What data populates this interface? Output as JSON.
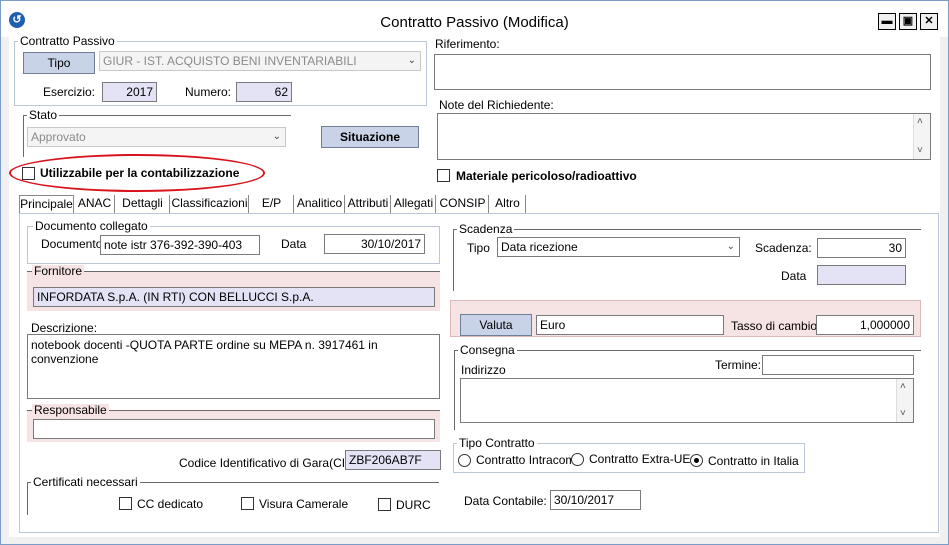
{
  "window": {
    "title": "Contratto Passivo (Modifica)",
    "minimize_symbol": "▬",
    "maximize_symbol": "▣",
    "close_symbol": "✕"
  },
  "contratto_passivo": {
    "group_label": "Contratto Passivo",
    "tipo_button": "Tipo",
    "tipo_value": "GIUR - IST. ACQUISTO BENI INVENTARIABILI",
    "esercizio_label": "Esercizio:",
    "esercizio_value": "2017",
    "numero_label": "Numero:",
    "numero_value": "62"
  },
  "riferimento": {
    "label": "Riferimento:",
    "value": ""
  },
  "note_richiedente": {
    "label": "Note del Richiedente:",
    "value": ""
  },
  "stato": {
    "group_label": "Stato",
    "value": "Approvato",
    "situazione_button": "Situazione"
  },
  "utilizzabile_label": "Utilizzabile per la contabilizzazione",
  "materiale_label": "Materiale pericoloso/radioattivo",
  "tabs": [
    {
      "label": "Principale"
    },
    {
      "label": "ANAC"
    },
    {
      "label": "Dettagli"
    },
    {
      "label": "Classificazioni"
    },
    {
      "label": "E/P"
    },
    {
      "label": "Analitico"
    },
    {
      "label": "Attributi"
    },
    {
      "label": "Allegati"
    },
    {
      "label": "CONSIP"
    },
    {
      "label": "Altro"
    }
  ],
  "documento_collegato": {
    "group_label": "Documento collegato",
    "documento_label": "Documento",
    "documento_value": "note istr 376-392-390-403",
    "data_label": "Data",
    "data_value": "30/10/2017"
  },
  "fornitore": {
    "group_label": "Fornitore",
    "value": "INFORDATA S.p.A. (IN RTI) CON BELLUCCI S.p.A."
  },
  "descrizione": {
    "label": "Descrizione:",
    "value": "notebook docenti -QUOTA PARTE ordine su MEPA n. 3917461  in convenzione"
  },
  "responsabile": {
    "group_label": "Responsabile",
    "value": ""
  },
  "cig": {
    "label": "Codice Identificativo di Gara(CIG)",
    "value": "ZBF206AB7F"
  },
  "certificati": {
    "group_label": "Certificati necessari",
    "items": [
      {
        "label": "CC dedicato"
      },
      {
        "label": "Visura Camerale"
      },
      {
        "label": "DURC"
      }
    ]
  },
  "scadenza": {
    "group_label": "Scadenza",
    "tipo_label": "Tipo",
    "tipo_value": "Data ricezione",
    "scadenza_label": "Scadenza:",
    "scadenza_value": "30",
    "data_label": "Data",
    "data_value": ""
  },
  "valuta": {
    "button": "Valuta",
    "value": "Euro",
    "tasso_label": "Tasso di cambio:",
    "tasso_value": "1,000000"
  },
  "consegna": {
    "group_label": "Consegna",
    "indirizzo_label": "Indirizzo",
    "termine_label": "Termine:",
    "termine_value": "",
    "indirizzo_value": ""
  },
  "tipo_contratto": {
    "group_label": "Tipo Contratto",
    "options": [
      {
        "label": "Contratto Intracom."
      },
      {
        "label": "Contratto Extra-UE"
      },
      {
        "label": "Contratto in Italia"
      }
    ]
  },
  "data_contabile": {
    "label": "Data Contabile:",
    "value": "30/10/2017"
  },
  "colors": {
    "annotation_ellipse": "#d8131c",
    "button_bg": "#c9d3e8",
    "pink_panel": "#f6e3e3",
    "lavender_field": "#e3e3f5"
  }
}
